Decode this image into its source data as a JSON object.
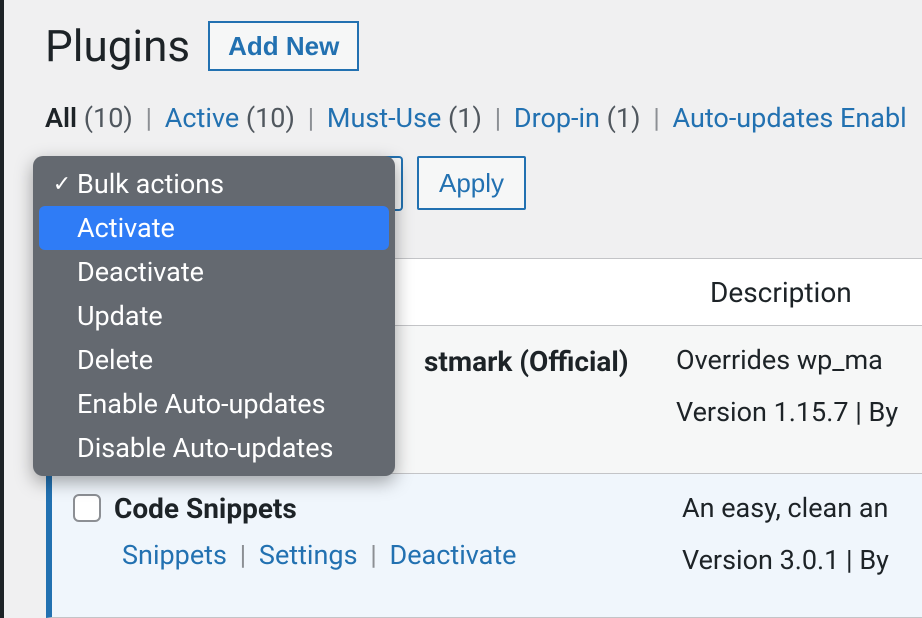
{
  "header": {
    "title": "Plugins",
    "add_new": "Add New"
  },
  "filters": {
    "all_label": "All",
    "all_count": "(10)",
    "active_label": "Active",
    "active_count": "(10)",
    "mustuse_label": "Must-Use",
    "mustuse_count": "(1)",
    "dropin_label": "Drop-in",
    "dropin_count": "(1)",
    "auto_label": "Auto-updates Enabl"
  },
  "bulk": {
    "apply": "Apply",
    "options": {
      "bulk_actions": "Bulk actions",
      "activate": "Activate",
      "deactivate": "Deactivate",
      "update": "Update",
      "delete": "Delete",
      "enable_auto": "Enable Auto-updates",
      "disable_auto": "Disable Auto-updates"
    }
  },
  "table": {
    "desc_header": "Description"
  },
  "plugins": [
    {
      "name_fragment": "stmark (Official)",
      "desc1": "Overrides wp_ma",
      "desc2": "Version 1.15.7 | By"
    },
    {
      "name_fragment": "Code Snippets",
      "links": {
        "snippets": "Snippets",
        "settings": "Settings",
        "deactivate": "Deactivate"
      },
      "desc1": "An easy, clean an",
      "desc2": "Version 3.0.1 | By"
    }
  ]
}
